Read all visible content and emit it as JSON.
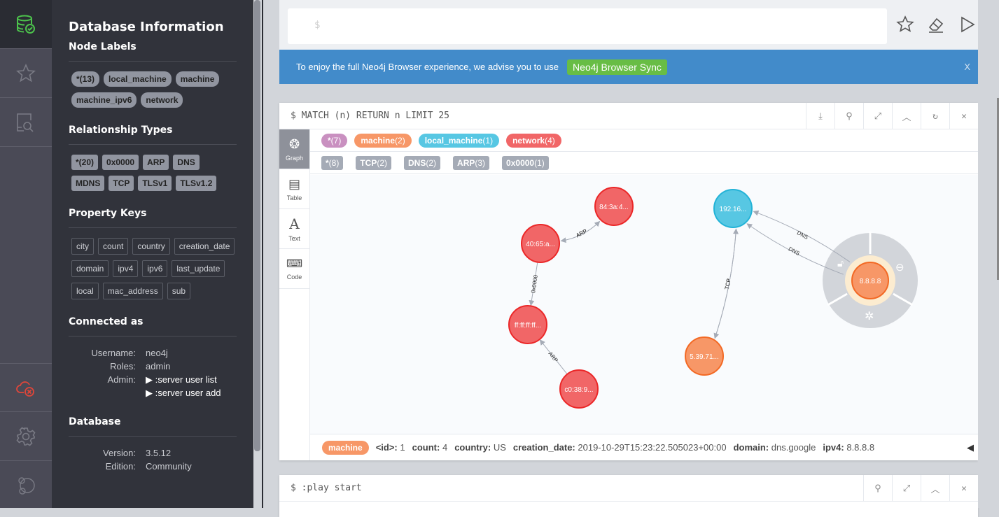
{
  "iconbar": {
    "items": [
      "database-icon",
      "star-icon",
      "search-doc-icon",
      "disconnected-cloud-icon",
      "gear-icon",
      "neo4j-logo-icon"
    ],
    "active_color": "#4cc24c",
    "error_color": "#e0463a"
  },
  "drawer": {
    "title": "Database Information",
    "node_labels_title": "Node Labels",
    "node_labels": [
      "*(13)",
      "local_machine",
      "machine",
      "machine_ipv6",
      "network"
    ],
    "rel_types_title": "Relationship Types",
    "rel_types": [
      "*(20)",
      "0x0000",
      "ARP",
      "DNS",
      "MDNS",
      "TCP",
      "TLSv1",
      "TLSv1.2"
    ],
    "prop_keys_title": "Property Keys",
    "prop_keys": [
      "city",
      "count",
      "country",
      "creation_date",
      "domain",
      "ipv4",
      "ipv6",
      "last_update",
      "local",
      "mac_address",
      "sub"
    ],
    "connected_title": "Connected as",
    "username_label": "Username:",
    "username": "neo4j",
    "roles_label": "Roles:",
    "roles": "admin",
    "admin_label": "Admin:",
    "admin_cmds": [
      ":server user list",
      ":server user add"
    ],
    "database_title": "Database",
    "version_label": "Version:",
    "version": "3.5.12",
    "edition_label": "Edition:",
    "edition": "Community"
  },
  "editor": {
    "prompt": "$"
  },
  "banner": {
    "text": "To enjoy the full Neo4j Browser experience, we advise you to use",
    "link": "Neo4j Browser Sync",
    "close": "X"
  },
  "frame1": {
    "query": "$ MATCH (n) RETURN n LIMIT 25",
    "tabs": [
      "Graph",
      "Table",
      "Text",
      "Code"
    ],
    "node_labels": [
      {
        "name": "*",
        "count": "(7)",
        "color": "#c990c0"
      },
      {
        "name": "machine",
        "count": "(2)",
        "color": "#f79767"
      },
      {
        "name": "local_machine",
        "count": "(1)",
        "color": "#57c7e3"
      },
      {
        "name": "network",
        "count": "(4)",
        "color": "#f16667"
      }
    ],
    "rel_types": [
      {
        "name": "*",
        "count": "(8)"
      },
      {
        "name": "TCP",
        "count": "(2)"
      },
      {
        "name": "DNS",
        "count": "(2)"
      },
      {
        "name": "ARP",
        "count": "(3)"
      },
      {
        "name": "0x0000",
        "count": "(1)"
      }
    ],
    "nodes": [
      {
        "id": "a",
        "label": "84:3a:4...",
        "type": "network"
      },
      {
        "id": "b",
        "label": "40:65:a...",
        "type": "network"
      },
      {
        "id": "c",
        "label": "ff:ff:ff:ff...",
        "type": "network"
      },
      {
        "id": "d",
        "label": "c0:38:9...",
        "type": "network"
      },
      {
        "id": "e",
        "label": "192.16...",
        "type": "local_machine"
      },
      {
        "id": "f",
        "label": "5.39.71...",
        "type": "machine"
      },
      {
        "id": "g",
        "label": "8.8.8.8",
        "type": "machine",
        "selected": true
      }
    ],
    "edges": [
      {
        "from": "b",
        "to": "a",
        "label": "ARP"
      },
      {
        "from": "a",
        "to": "b",
        "label": "ARP"
      },
      {
        "from": "b",
        "to": "c",
        "label": "0x0000"
      },
      {
        "from": "d",
        "to": "c",
        "label": "ARP"
      },
      {
        "from": "f",
        "to": "e",
        "label": "TCP"
      },
      {
        "from": "e",
        "to": "f",
        "label": "TCP"
      },
      {
        "from": "g",
        "to": "e",
        "label": "DNS"
      },
      {
        "from": "g",
        "to": "e",
        "label": "DNS"
      }
    ],
    "footer": {
      "label": "machine",
      "props": [
        {
          "k": "<id>:",
          "v": "1"
        },
        {
          "k": "count:",
          "v": "4"
        },
        {
          "k": "country:",
          "v": "US"
        },
        {
          "k": "creation_date:",
          "v": "2019-10-29T15:23:22.505023+00:00"
        },
        {
          "k": "domain:",
          "v": "dns.google"
        },
        {
          "k": "ipv4:",
          "v": "8.8.8.8"
        }
      ]
    }
  },
  "frame2": {
    "query": "$ :play start"
  }
}
